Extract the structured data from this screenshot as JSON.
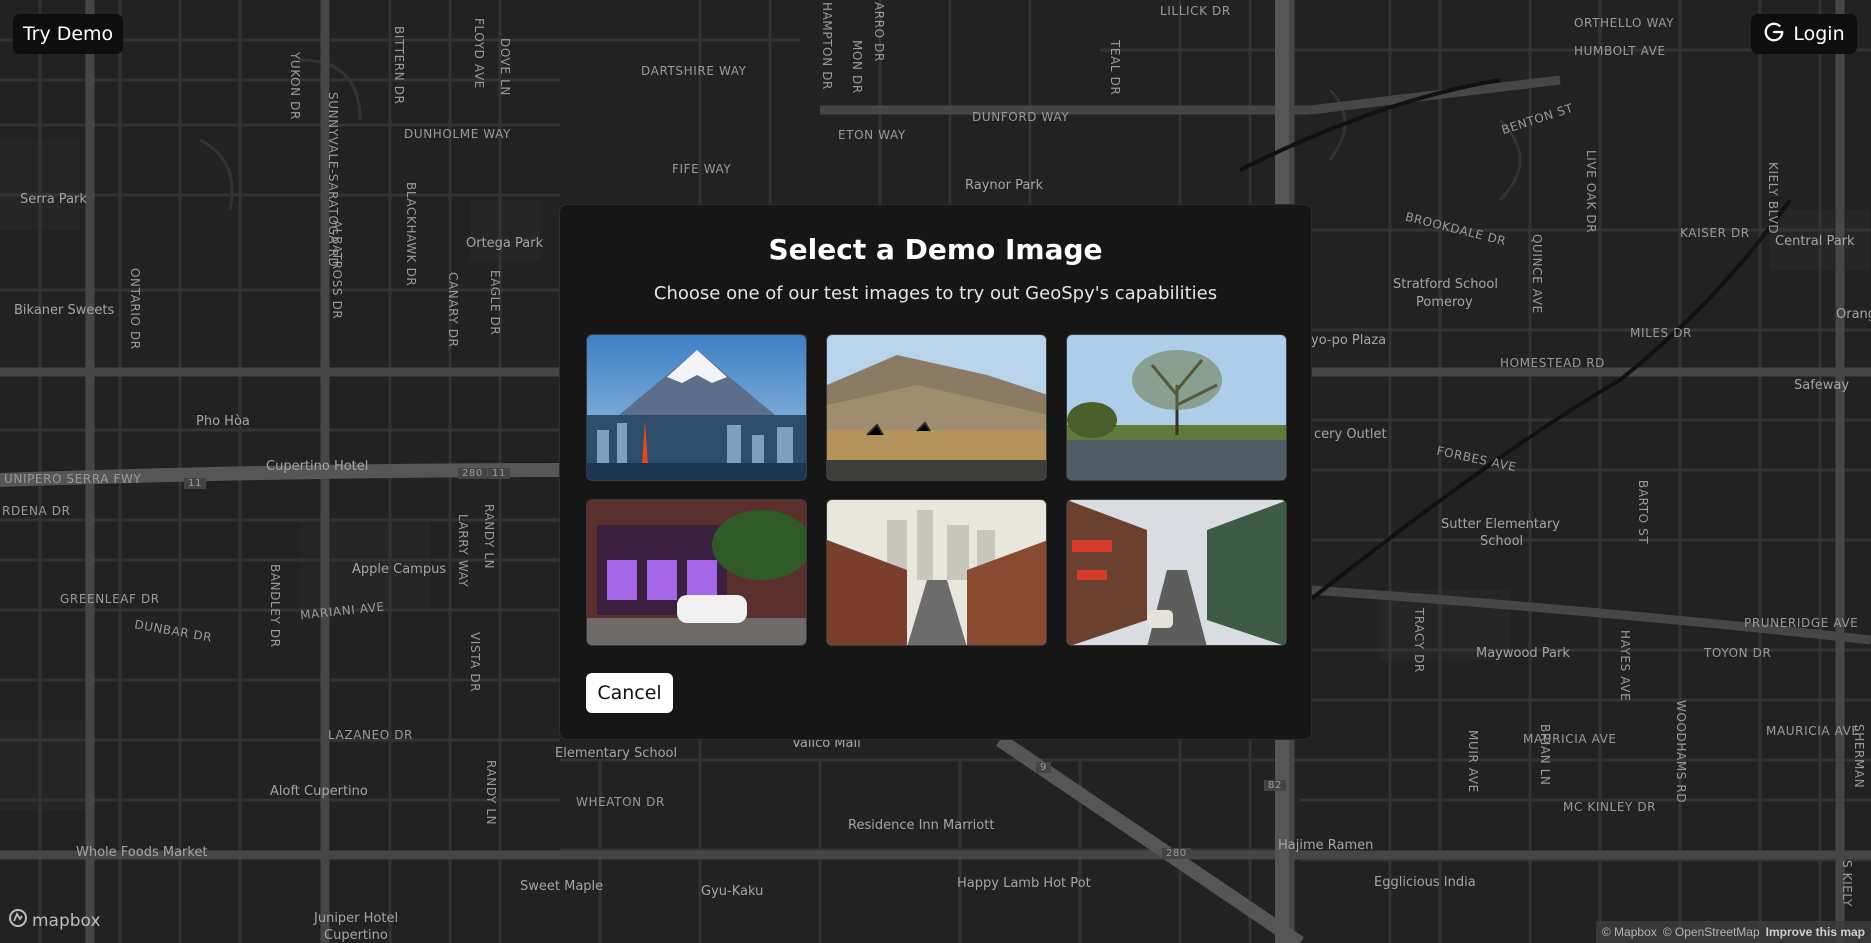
{
  "header": {
    "try_demo_label": "Try Demo",
    "login_label": "Login"
  },
  "modal": {
    "title": "Select a Demo Image",
    "subtitle": "Choose one of our test images to try out GeoSpy's capabilities",
    "cancel_label": "Cancel",
    "images": [
      {
        "subject": "mount-fuji-tokyo-tower"
      },
      {
        "subject": "oil-field-hills"
      },
      {
        "subject": "park-willow-pond"
      },
      {
        "subject": "purple-storefront-white-car"
      },
      {
        "subject": "city-street-skyline"
      },
      {
        "subject": "chinatown-street"
      }
    ]
  },
  "map": {
    "streets": [
      "DARTSHIRE WAY",
      "DUNHOLME WAY",
      "FIFE WAY",
      "ETON WAY",
      "DUNFORD WAY",
      "ORTHELLO WAY",
      "HUMBOLT AVE",
      "BENTON ST",
      "BROOKDALE DR",
      "KAISER DR",
      "MILES DR",
      "HOMESTEAD RD",
      "FORBES AVE",
      "PRUNERIDGE AVE",
      "TOYON DR",
      "MAURICIA AVE",
      "MAURICIA AVE",
      "MC KINLEY DR",
      "GREENLEAF DR",
      "DUNBAR DR",
      "MARIANI AVE",
      "LAZANEO DR",
      "WHEATON DR",
      "UNIPERO SERRA FWY",
      "RDENA DR",
      "LILLICK DR"
    ],
    "vertical_streets": [
      "YUKON DR",
      "SUNNYVALE-SARATOGA RD",
      "BITTERN DR",
      "FLOYD AVE",
      "DOVE LN",
      "HAMPTON DR",
      "ARRO DR",
      "MON DR",
      "TEAL DR",
      "ONTARIO DR",
      "ALBATROSS DR",
      "BLACKHAWK DR",
      "CANARY DR",
      "EAGLE DR",
      "LARRY WAY",
      "RANDY LN",
      "BANDLEY DR",
      "VISTA DR",
      "RANDY LN",
      "QUINCE AVE",
      "LIVE OAK DR",
      "KIELY BLVD",
      "BARTO ST",
      "TRACY DR",
      "HAYES AVE",
      "MUIR AVE",
      "BRIAN LN",
      "WOODHAMS RD",
      "S KIELY",
      "SHERMAN"
    ],
    "pois": [
      "Serra Park",
      "Bikaner Sweets",
      "Pho Hòa",
      "Ortega Park",
      "Raynor Park",
      "Cupertino Hotel",
      "Apple Campus",
      "Aloft Cupertino",
      "Whole Foods Market",
      "Sweet Maple",
      "Gyu-Kaku",
      "Juniper Hotel",
      "Cupertino",
      "Happy Lamb Hot Pot",
      "Residence Inn Marriott",
      "Vallco Mall",
      "Elementary School",
      "Stratford School",
      "Pomeroy",
      "yo-po Plaza",
      "cery Outlet",
      "Sutter Elementary",
      "School",
      "Maywood Park",
      "Central Park",
      "Safeway",
      "Orang",
      "Hajime Ramen",
      "Egglicious India"
    ],
    "route_shields": [
      "11",
      "280",
      "11",
      "280",
      "9",
      "82",
      "280"
    ],
    "attribution": {
      "mapbox": "© Mapbox",
      "osm": "© OpenStreetMap",
      "improve": "Improve this map"
    },
    "logo_text": "mapbox"
  },
  "colors": {
    "map_bg": "#222222",
    "road": "#3a3a3a",
    "major_road": "#4a4a4a",
    "modal_bg": "#161616",
    "button_bg": "#0e0e0e"
  }
}
